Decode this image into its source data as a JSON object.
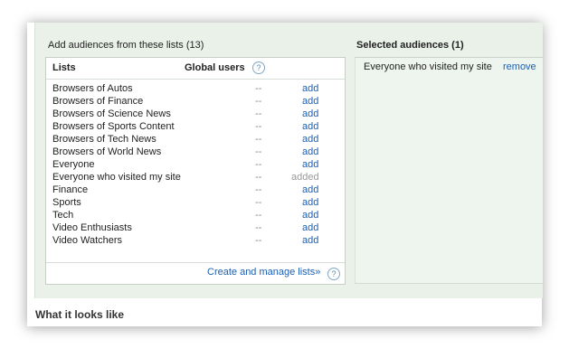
{
  "available": {
    "title": "Add audiences from these lists (13)",
    "col_lists": "Lists",
    "col_users": "Global users",
    "help_glyph": "?",
    "items": [
      {
        "name": "Browsers of Autos",
        "users": "--",
        "action": "add"
      },
      {
        "name": "Browsers of Finance",
        "users": "--",
        "action": "add"
      },
      {
        "name": "Browsers of Science News",
        "users": "--",
        "action": "add"
      },
      {
        "name": "Browsers of Sports Content",
        "users": "--",
        "action": "add"
      },
      {
        "name": "Browsers of Tech News",
        "users": "--",
        "action": "add"
      },
      {
        "name": "Browsers of World News",
        "users": "--",
        "action": "add"
      },
      {
        "name": "Everyone",
        "users": "--",
        "action": "add"
      },
      {
        "name": "Everyone who visited my site",
        "users": "--",
        "action": "added"
      },
      {
        "name": "Finance",
        "users": "--",
        "action": "add"
      },
      {
        "name": "Sports",
        "users": "--",
        "action": "add"
      },
      {
        "name": "Tech",
        "users": "--",
        "action": "add"
      },
      {
        "name": "Video Enthusiasts",
        "users": "--",
        "action": "add"
      },
      {
        "name": "Video Watchers",
        "users": "--",
        "action": "add"
      }
    ],
    "manage_link": "Create and manage lists»"
  },
  "selected": {
    "title": "Selected audiences (1)",
    "items": [
      {
        "name": "Everyone who visited my site",
        "action": "remove"
      }
    ]
  },
  "preview_title": "What it looks like",
  "colors": {
    "link": "#1a5fb4",
    "panel_bg": "#e9f1e9",
    "muted": "#999999"
  }
}
